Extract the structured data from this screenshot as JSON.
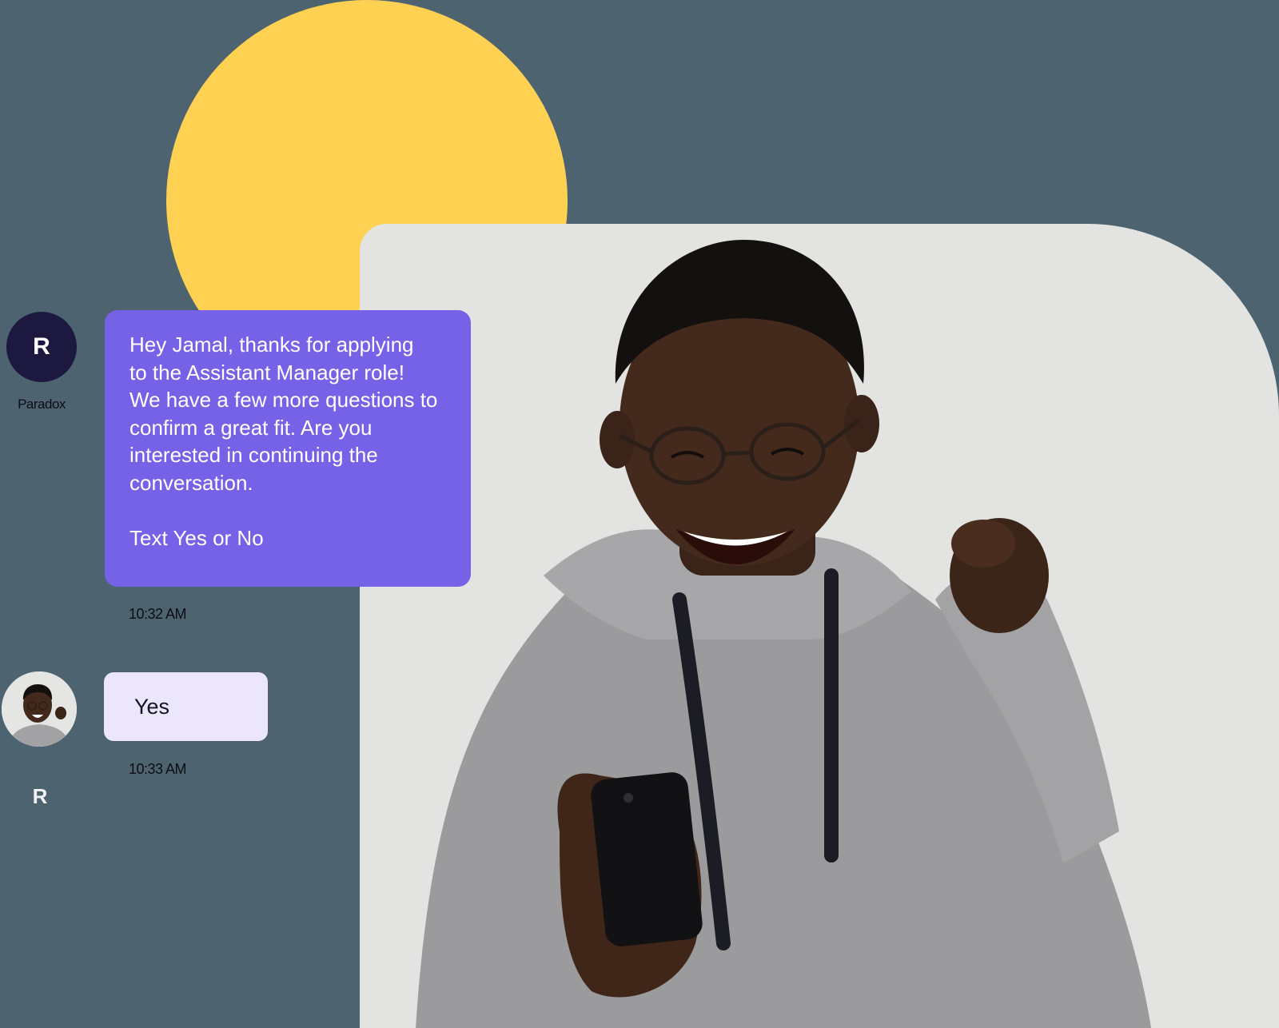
{
  "colors": {
    "background": "#4d6470",
    "accent_circle": "#ffd152",
    "photo_panel": "#e3e3e1",
    "recruiter_bubble": "#7662e6",
    "reply_bubble": "#ebe6fb",
    "recruiter_avatar": "#1c1840"
  },
  "recruiter": {
    "avatar_letter": "R",
    "name": "Paradox",
    "message": "Hey Jamal, thanks for applying\nto the Assistant Manager role!\nWe have a few more questions to\nconfirm a great fit. Are you\ninterested in continuing the\nconversation.\n\nText Yes or No",
    "timestamp": "10:32 AM"
  },
  "candidate": {
    "reply": "Yes",
    "timestamp": "10:33 AM"
  },
  "logo": {
    "letter": "R"
  },
  "icons": {
    "photo": "person-celebrating-with-phone",
    "candidate_avatar": "candidate-avatar-photo"
  }
}
